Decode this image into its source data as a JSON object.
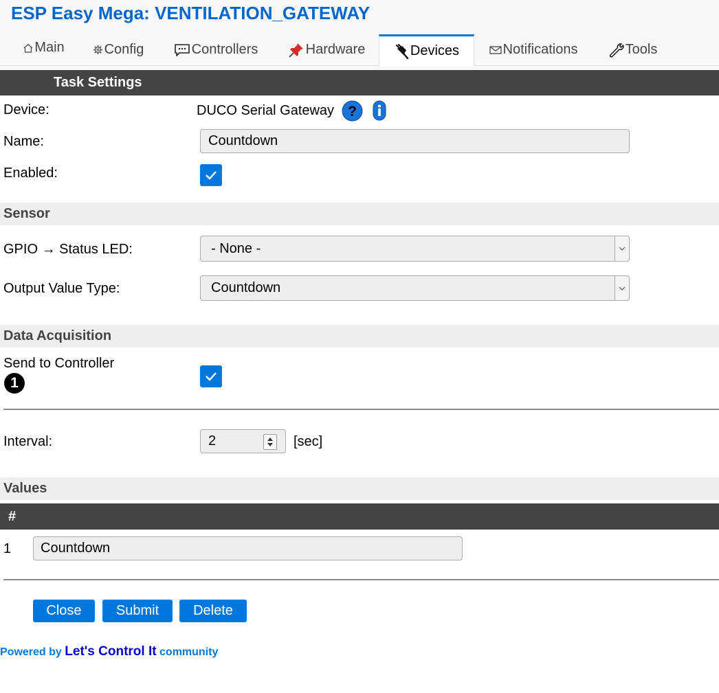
{
  "app": {
    "title": "ESP Easy Mega: VENTILATION_GATEWAY"
  },
  "tabs": [
    {
      "label": "Main",
      "icon": "home-icon"
    },
    {
      "label": "Config",
      "icon": "gear-icon"
    },
    {
      "label": "Controllers",
      "icon": "chat-icon"
    },
    {
      "label": "Hardware",
      "icon": "pushpin-icon"
    },
    {
      "label": "Devices",
      "icon": "plug-icon",
      "active": true
    },
    {
      "label": "Notifications",
      "icon": "envelope-icon"
    },
    {
      "label": "Tools",
      "icon": "wrench-icon"
    }
  ],
  "task_settings": {
    "header": "Task Settings",
    "device_label": "Device:",
    "device_value": "DUCO Serial Gateway",
    "name_label": "Name:",
    "name_value": "Countdown",
    "enabled_label": "Enabled:",
    "enabled": true
  },
  "sensor": {
    "header": "Sensor",
    "gpio_label": "GPIO → Status LED:",
    "gpio_value": "- None -",
    "output_label": "Output Value Type:",
    "output_value": "Countdown"
  },
  "data_acquisition": {
    "header": "Data Acquisition",
    "send_label": "Send to Controller",
    "controller_number": "1",
    "send_enabled": true,
    "interval_label": "Interval:",
    "interval_value": "2",
    "interval_unit": "[sec]"
  },
  "values": {
    "header": "Values",
    "column_header": "#",
    "rows": [
      {
        "index": "1",
        "name": "Countdown"
      }
    ]
  },
  "buttons": {
    "close": "Close",
    "submit": "Submit",
    "delete": "Delete"
  },
  "footer": {
    "prefix": "Powered by",
    "link": "Let's Control It",
    "suffix": "community"
  },
  "colors": {
    "accent": "#0077dd",
    "title": "#0066cc",
    "dark_band": "#444444",
    "light_band": "#eeeeee"
  }
}
